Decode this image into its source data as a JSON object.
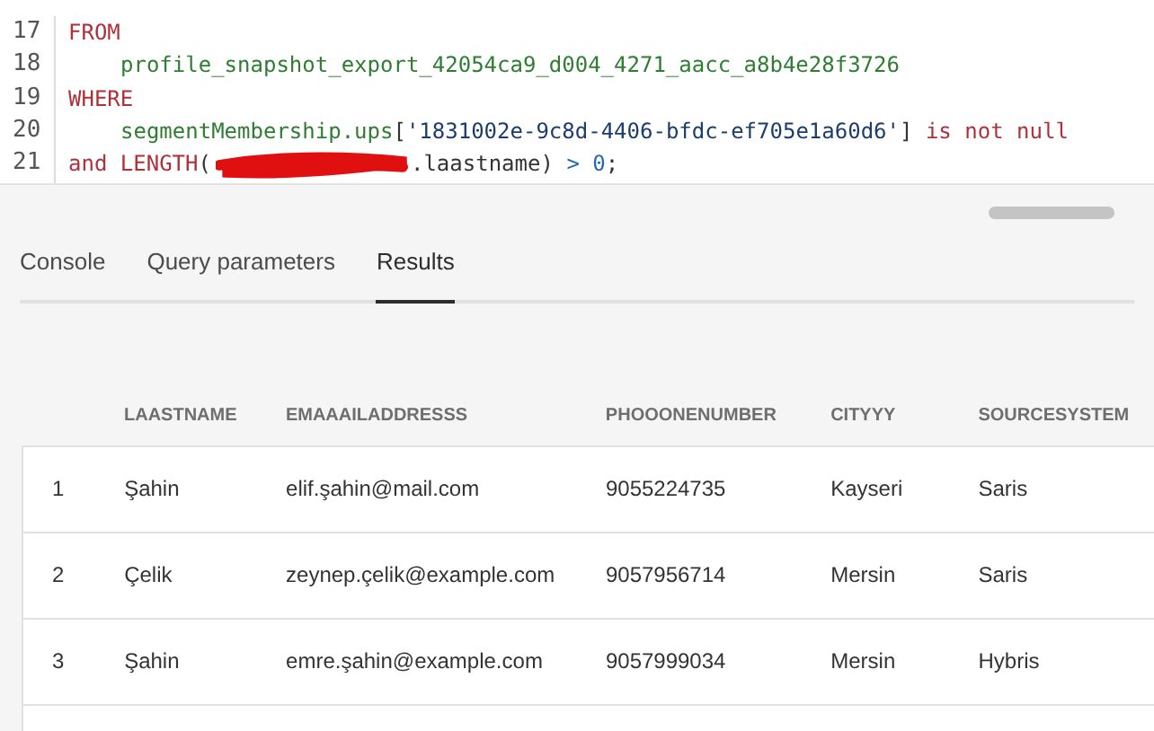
{
  "code_lines": [
    {
      "number": "17",
      "indented": false,
      "tokens": [
        {
          "kind": "keyword",
          "text": "FROM"
        }
      ]
    },
    {
      "number": "18",
      "indented": true,
      "tokens": [
        {
          "kind": "identifier",
          "text": "profile_snapshot_export_42054ca9_d004_4271_aacc_a8b4e28f3726"
        }
      ]
    },
    {
      "number": "19",
      "indented": false,
      "tokens": [
        {
          "kind": "keyword",
          "text": "WHERE"
        }
      ]
    },
    {
      "number": "20",
      "indented": true,
      "tokens": [
        {
          "kind": "identifier",
          "text": "segmentMembership.ups"
        },
        {
          "kind": "plain",
          "text": "["
        },
        {
          "kind": "string",
          "text": "'1831002e-9c8d-4406-bfdc-ef705e1a60d6'"
        },
        {
          "kind": "plain",
          "text": "] "
        },
        {
          "kind": "keyword",
          "text": "is not null"
        }
      ]
    },
    {
      "number": "21",
      "indented": false,
      "tokens": [
        {
          "kind": "keyword",
          "text": "and LENGTH"
        },
        {
          "kind": "plain",
          "text": "("
        },
        {
          "kind": "redacted"
        },
        {
          "kind": "plain",
          "text": ".laastname) "
        },
        {
          "kind": "operator",
          "text": "> "
        },
        {
          "kind": "number",
          "text": "0"
        },
        {
          "kind": "plain",
          "text": ";"
        }
      ]
    }
  ],
  "tabs": [
    {
      "label": "Console",
      "selected": false
    },
    {
      "label": "Query parameters",
      "selected": false
    },
    {
      "label": "Results",
      "selected": true
    }
  ],
  "table": {
    "columns": [
      "LAASTNAME",
      "EMAAAILADDRESSS",
      "PHOOONENUMBER",
      "CITYYY",
      "SOURCESYSTEM"
    ],
    "rows": [
      {
        "index": "1",
        "cells": [
          "Şahin",
          "elif.şahin@mail.com",
          "9055224735",
          "Kayseri",
          "Saris"
        ]
      },
      {
        "index": "2",
        "cells": [
          "Çelik",
          "zeynep.çelik@example.com",
          "9057956714",
          "Mersin",
          "Saris"
        ]
      },
      {
        "index": "3",
        "cells": [
          "Şahin",
          "emre.şahin@example.com",
          "9057999034",
          "Mersin",
          "Hybris"
        ]
      }
    ]
  }
}
